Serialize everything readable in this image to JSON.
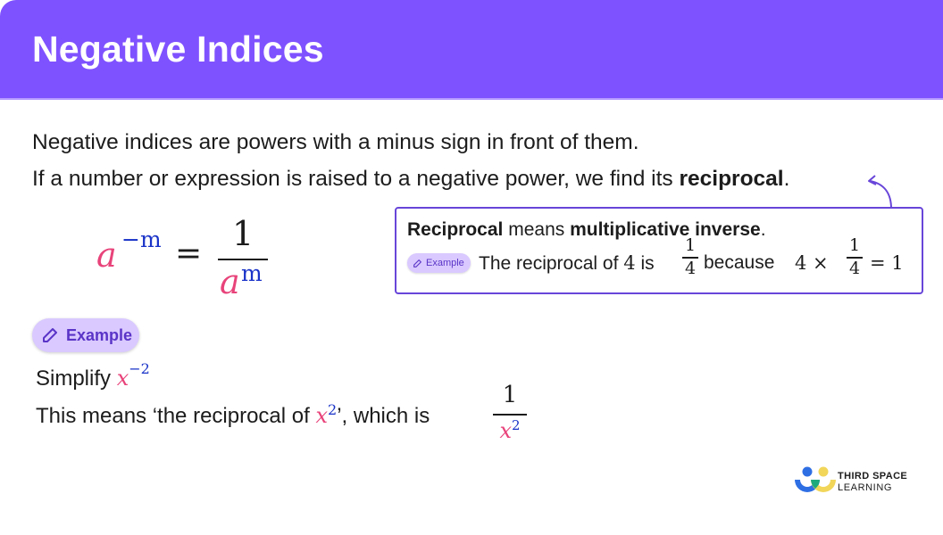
{
  "header": {
    "title": "Negative Indices",
    "background_color": "#7f52ff"
  },
  "intro": {
    "line1": "Negative indices are powers with a minus sign in front of them.",
    "line2_prefix": "If a number or expression is raised to a negative power, we find its ",
    "line2_bold": "reciprocal",
    "line2_suffix": "."
  },
  "formula": {
    "base": "a",
    "exponent": "−m",
    "equals": "=",
    "numerator": "1",
    "denominator_base": "a",
    "denominator_exponent": "m"
  },
  "callout": {
    "term": "Reciprocal",
    "means": " means ",
    "definition": "multiplicative inverse",
    "period": ".",
    "chip_label": "Example",
    "example_prefix": "The reciprocal of ",
    "number": "4",
    "is": " is ",
    "frac_num": "1",
    "frac_den": "4",
    "because": "because",
    "product_left": "4 ×",
    "product_frac_num": "1",
    "product_frac_den": "4",
    "product_result": "= 1",
    "border_color": "#6845d9"
  },
  "example": {
    "chip_label": "Example",
    "line1_text": "Simplify ",
    "line1_base": "x",
    "line1_exp": "−2",
    "line2_prefix": "This means ‘the reciprocal of ",
    "line2_base": "x",
    "line2_exp": "2",
    "line2_mid": "’, which is ",
    "answer_num": "1",
    "answer_den_base": "x",
    "answer_den_exp": "2"
  },
  "logo": {
    "line1": "THIRD SPACE",
    "line2": "LEARNING",
    "colors": [
      "#2f6fe4",
      "#f1d65a",
      "#1ea97c"
    ]
  },
  "colors": {
    "variable": "#e8437a",
    "exponent": "#1a33c8",
    "chip_bg": "#d9c9ff",
    "chip_text": "#5a34c7"
  }
}
